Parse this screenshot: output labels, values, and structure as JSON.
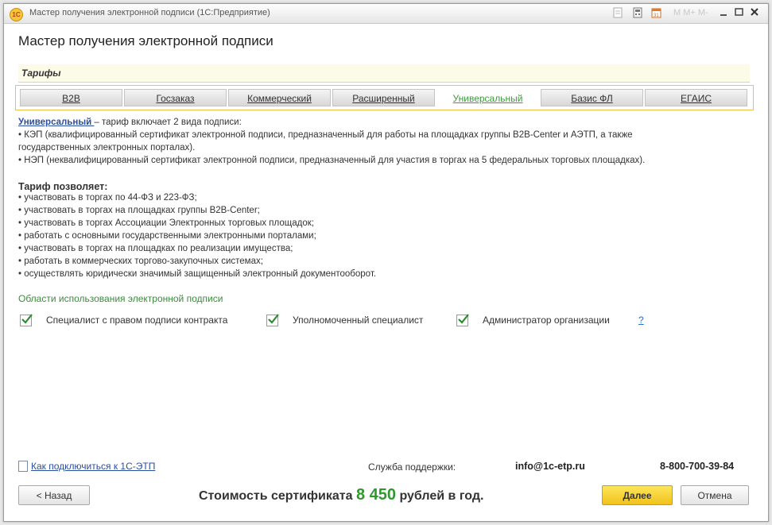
{
  "window": {
    "title": "Мастер получения электронной подписи  (1С:Предприятие)",
    "app_icon": "1С",
    "faded_label": "М  М+  М-"
  },
  "header": {
    "title": "Мастер получения электронной подписи"
  },
  "section": {
    "label": "Тарифы"
  },
  "tabs": [
    {
      "label": "B2B",
      "active": false
    },
    {
      "label": "Госзаказ",
      "active": false
    },
    {
      "label": "Коммерческий",
      "active": false
    },
    {
      "label": "Расширенный",
      "active": false
    },
    {
      "label": "Универсальный",
      "active": true
    },
    {
      "label": "Базис ФЛ",
      "active": false
    },
    {
      "label": "ЕГАИС",
      "active": false
    }
  ],
  "description": {
    "tariff_name": "Универсальный ",
    "intro": " – тариф включает 2 вида подписи:",
    "line1": "• КЭП (квалифицированный сертификат электронной подписи, предназначенный для работы на площадках группы B2B-Center и АЭТП, а также",
    "line2": "государственных электронных порталах).",
    "line3": "• НЭП (неквалифицированный сертификат электронной подписи, предназначенный для участия в торгах на 5 федеральных торговых площадках)."
  },
  "allows": {
    "title": "Тариф позволяет:",
    "items": [
      "• участвовать в торгах по 44-ФЗ и 223-ФЗ;",
      "• участвовать в торгах на площадках группы B2B-Center;",
      "• участвовать в торгах Ассоциации Электронных торговых площадок;",
      "• работать с основными государственными электронными порталами;",
      "• участвовать в торгах на площадках по реализации имущества;",
      "• работать в коммерческих торгово-закупочных системах;",
      "• осуществлять юридически значимый защищенный электронный документооборот."
    ]
  },
  "areas": {
    "title": "Области использования электронной подписи",
    "checkboxes": [
      {
        "label": "Специалист с правом подписи контракта",
        "checked": true
      },
      {
        "label": "Уполномоченный специалист",
        "checked": true
      },
      {
        "label": "Администратор организации",
        "checked": true
      }
    ],
    "help": "?"
  },
  "footer": {
    "connect_link": "Как подключиться к 1С-ЭТП",
    "support_label": "Служба поддержки:",
    "email": "info@1c-etp.ru",
    "phone": "8-800-700-39-84",
    "cost_prefix": "Стоимость сертификата ",
    "cost_amount": "8 450",
    "cost_suffix": " рублей в год.",
    "back_label": "< Назад",
    "next_label": "Далее",
    "cancel_label": "Отмена"
  },
  "colors": {
    "accent_green": "#2c9a2c",
    "link_blue": "#2a4fa0",
    "primary_yellow": "#f2c21a"
  }
}
